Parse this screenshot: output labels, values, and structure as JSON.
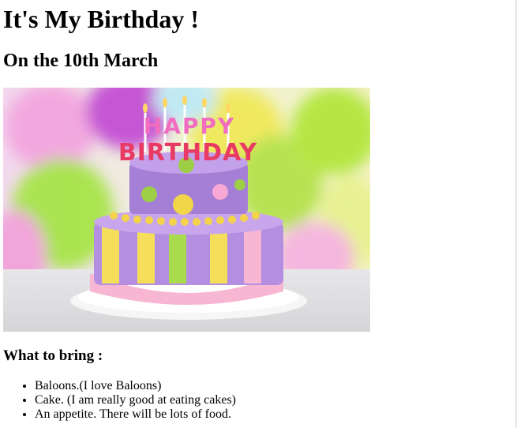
{
  "page": {
    "title": "It's My Birthday !",
    "date_heading": "On the 10th March",
    "hero_image": {
      "alt": "birthday cake",
      "topper_line1": "HAPPY",
      "topper_line2": "BIRTHDAY"
    },
    "bring_heading": "What to bring :",
    "bring_items": [
      "Baloons.(I love Baloons)",
      "Cake. (I am really good at eating cakes)",
      "An appetite. There will be lots of food."
    ]
  },
  "colors": {
    "text": "#000000",
    "background": "#ffffff"
  }
}
